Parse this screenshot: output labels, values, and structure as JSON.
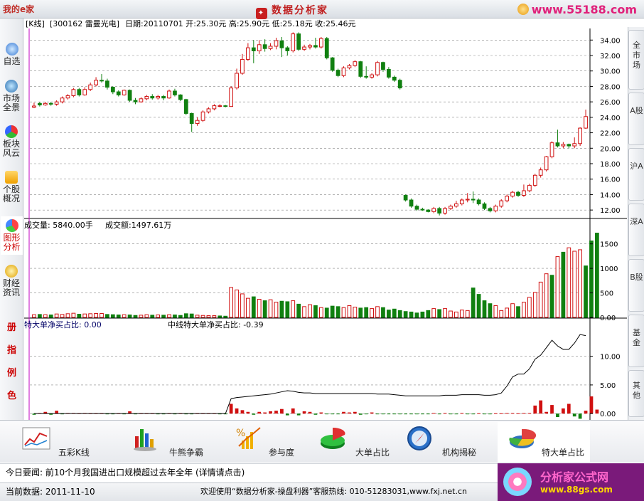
{
  "titlebar": {
    "left_logo": "我的e家",
    "app_title": "数据分析家",
    "site_link": "www.55188.com"
  },
  "left_nav": {
    "items": [
      {
        "label": "自选",
        "icon": "magnifier-icon"
      },
      {
        "label": "市场全景",
        "icon": "globe-icon"
      },
      {
        "label": "板块风云",
        "icon": "blocks-icon"
      },
      {
        "label": "个股概况",
        "icon": "stock-trend-icon"
      },
      {
        "label": "图形分析",
        "icon": "chart-graph-icon"
      },
      {
        "label": "财经资讯",
        "icon": "news-icon"
      },
      {
        "label": "册",
        "icon": ""
      },
      {
        "label": "指",
        "icon": ""
      },
      {
        "label": "例",
        "icon": ""
      },
      {
        "label": "色",
        "icon": ""
      }
    ]
  },
  "right_nav": {
    "items": [
      "全市场",
      "A股",
      "沪A",
      "深A",
      "B股",
      "基金",
      "其他"
    ]
  },
  "kline_header": {
    "chart_type": "[K线]",
    "stock": "[300162 雷曼光电]",
    "info": "日期:20110701 开:25.30元 高:25.90元 低:25.18元 收:25.46元"
  },
  "volume_header": {
    "volume": "成交量: 5840.00手",
    "amount": "成交额:1497.61万"
  },
  "indicator_header": {
    "left": "特大单净买占比: 0.00",
    "right": "中线特大单净买占比: -0.39"
  },
  "colors": {
    "up": "#d01010",
    "down": "#108010",
    "grid": "#888888",
    "cursor": "#c000c0",
    "line": "#000000"
  },
  "toolbar": {
    "items": [
      {
        "label": "五彩K线",
        "icon": "colorful-kline-icon"
      },
      {
        "label": "牛熊争霸",
        "icon": "bull-bear-icon"
      },
      {
        "label": "参与度",
        "icon": "percent-chart-icon"
      },
      {
        "label": "大单占比",
        "icon": "big-order-icon"
      },
      {
        "label": "机构揭秘",
        "icon": "compass-icon"
      },
      {
        "label": "特大单占比",
        "icon": "pie-chart-icon"
      }
    ]
  },
  "news": {
    "text": "今日要闻:  前10个月我国进出口规模超过去年全年 (详情请点击)"
  },
  "status": {
    "left": "当前数据: 2011-11-10",
    "right": "欢迎使用“数据分析家-操盘利器”客服热线: 010-51283031,www.fxj.net.cn"
  },
  "ad": {
    "title": "分析家公式网",
    "url": "www.88gs.com"
  },
  "chart_data": [
    {
      "type": "candlestick",
      "title": "",
      "ylim": [
        11,
        35.5
      ],
      "yticks": [
        "12.00",
        "14.00",
        "16.00",
        "18.00",
        "20.00",
        "22.00",
        "24.00",
        "26.00",
        "28.00",
        "30.00",
        "32.00",
        "34.00"
      ],
      "candles": [
        [
          25.3,
          25.46,
          25.9,
          25.18
        ],
        [
          25.8,
          25.6,
          26.0,
          25.4
        ],
        [
          25.6,
          25.8,
          26.0,
          25.5
        ],
        [
          25.8,
          25.7,
          26.0,
          25.5
        ],
        [
          25.7,
          26.0,
          26.2,
          25.5
        ],
        [
          26.0,
          26.5,
          26.7,
          25.8
        ],
        [
          26.5,
          26.8,
          27.0,
          26.3
        ],
        [
          26.8,
          27.6,
          27.8,
          26.6
        ],
        [
          27.6,
          26.9,
          27.8,
          26.7
        ],
        [
          26.9,
          27.6,
          27.9,
          26.8
        ],
        [
          27.6,
          28.2,
          28.5,
          27.4
        ],
        [
          28.2,
          28.8,
          29.2,
          28.0
        ],
        [
          28.8,
          28.7,
          29.6,
          28.5
        ],
        [
          28.7,
          27.9,
          29.0,
          27.6
        ],
        [
          27.9,
          27.3,
          28.0,
          27.0
        ],
        [
          27.3,
          26.9,
          27.5,
          26.7
        ],
        [
          26.9,
          27.5,
          27.6,
          26.8
        ],
        [
          27.5,
          26.2,
          27.6,
          26.0
        ],
        [
          26.2,
          26.0,
          26.5,
          25.7
        ],
        [
          26.0,
          26.4,
          26.6,
          25.9
        ],
        [
          26.4,
          26.7,
          26.9,
          26.2
        ],
        [
          26.7,
          26.5,
          27.0,
          26.3
        ],
        [
          26.5,
          26.7,
          26.9,
          26.3
        ],
        [
          26.7,
          26.5,
          26.9,
          26.2
        ],
        [
          26.5,
          27.4,
          27.6,
          26.4
        ],
        [
          27.4,
          26.9,
          27.7,
          26.7
        ],
        [
          26.9,
          26.3,
          27.0,
          26.1
        ],
        [
          26.3,
          24.5,
          26.4,
          24.3
        ],
        [
          24.5,
          23.2,
          24.6,
          22.1
        ],
        [
          23.2,
          23.6,
          24.0,
          22.9
        ],
        [
          23.6,
          24.7,
          24.9,
          23.4
        ],
        [
          24.7,
          25.1,
          25.3,
          24.5
        ],
        [
          25.1,
          25.5,
          25.7,
          24.9
        ],
        [
          25.5,
          25.5,
          25.7,
          25.3
        ],
        [
          25.5,
          25.4,
          25.6,
          25.3
        ],
        [
          25.4,
          27.8,
          28.0,
          27.6
        ],
        [
          27.8,
          29.7,
          30.3,
          27.6
        ],
        [
          29.7,
          31.5,
          32.2,
          29.5
        ],
        [
          31.5,
          33.0,
          33.6,
          31.3
        ],
        [
          33.0,
          32.6,
          34.0,
          31.0
        ],
        [
          32.6,
          33.4,
          34.0,
          32.2
        ],
        [
          33.4,
          32.9,
          34.1,
          32.5
        ],
        [
          32.9,
          33.2,
          33.6,
          32.7
        ],
        [
          33.2,
          33.9,
          34.3,
          32.8
        ],
        [
          33.9,
          33.0,
          34.4,
          31.8
        ],
        [
          33.0,
          32.6,
          33.2,
          32.0
        ],
        [
          32.6,
          34.8,
          35.0,
          32.4
        ],
        [
          34.8,
          32.8,
          35.0,
          32.6
        ],
        [
          32.8,
          33.1,
          33.4,
          32.6
        ],
        [
          33.1,
          33.3,
          33.5,
          32.8
        ],
        [
          33.3,
          33.1,
          34.3,
          32.9
        ],
        [
          33.1,
          34.2,
          34.4,
          32.9
        ],
        [
          34.2,
          31.7,
          34.4,
          31.5
        ],
        [
          31.7,
          30.1,
          31.8,
          29.9
        ],
        [
          30.1,
          29.4,
          30.3,
          29.2
        ],
        [
          29.4,
          30.4,
          30.6,
          29.2
        ],
        [
          30.4,
          30.7,
          30.9,
          30.2
        ],
        [
          30.7,
          31.2,
          31.4,
          30.5
        ],
        [
          31.2,
          29.3,
          31.3,
          29.1
        ],
        [
          29.3,
          29.2,
          30.6,
          29.0
        ],
        [
          29.2,
          29.5,
          29.7,
          29.0
        ],
        [
          29.5,
          31.1,
          31.3,
          29.3
        ],
        [
          31.1,
          30.2,
          31.2,
          29.9
        ],
        [
          30.2,
          29.2,
          30.5,
          29.0
        ],
        [
          29.2,
          28.8,
          29.4,
          28.6
        ],
        [
          28.8,
          27.8,
          29.0,
          27.6
        ],
        [
          13.9,
          13.3,
          14.0,
          13.1
        ],
        [
          13.3,
          12.5,
          13.5,
          12.3
        ],
        [
          12.5,
          12.1,
          12.7,
          11.9
        ],
        [
          12.1,
          12.0,
          12.3,
          11.9
        ],
        [
          12.0,
          11.8,
          12.1,
          11.7
        ],
        [
          11.8,
          12.2,
          12.4,
          11.6
        ],
        [
          12.2,
          11.6,
          12.4,
          11.3
        ],
        [
          11.6,
          12.2,
          12.4,
          11.4
        ],
        [
          12.2,
          12.5,
          12.7,
          12.0
        ],
        [
          12.5,
          12.8,
          13.2,
          12.3
        ],
        [
          12.8,
          13.3,
          13.5,
          12.6
        ],
        [
          13.3,
          13.4,
          14.2,
          13.0
        ],
        [
          13.4,
          13.3,
          14.4,
          12.9
        ],
        [
          13.3,
          12.8,
          13.5,
          12.6
        ],
        [
          12.8,
          12.2,
          13.0,
          12.0
        ],
        [
          12.2,
          11.9,
          12.4,
          11.7
        ],
        [
          11.9,
          12.5,
          12.7,
          11.7
        ],
        [
          12.5,
          13.2,
          13.4,
          12.3
        ],
        [
          13.2,
          13.8,
          14.0,
          13.0
        ],
        [
          13.8,
          14.3,
          14.5,
          13.6
        ],
        [
          14.3,
          13.9,
          14.5,
          13.7
        ],
        [
          13.9,
          14.5,
          15.3,
          13.7
        ],
        [
          14.5,
          15.2,
          15.4,
          14.3
        ],
        [
          15.2,
          16.5,
          16.7,
          15.0
        ],
        [
          16.5,
          17.2,
          17.5,
          16.2
        ],
        [
          17.2,
          18.9,
          19.0,
          17.0
        ],
        [
          18.9,
          20.7,
          20.9,
          18.7
        ],
        [
          20.7,
          20.3,
          22.4,
          20.1
        ],
        [
          20.3,
          20.5,
          20.8,
          20.0
        ],
        [
          20.5,
          20.3,
          20.6,
          20.0
        ],
        [
          20.3,
          20.6,
          21.4,
          20.0
        ],
        [
          20.6,
          22.6,
          22.7,
          20.3
        ],
        [
          22.6,
          24.1,
          25.0,
          22.5
        ]
      ]
    },
    {
      "type": "bar",
      "title": "",
      "ylim": [
        0,
        1800
      ],
      "yticks": [
        "0.00",
        "500",
        "1000",
        "1500"
      ],
      "values": [
        55,
        60,
        55,
        50,
        70,
        60,
        75,
        85,
        65,
        70,
        75,
        80,
        80,
        60,
        55,
        50,
        55,
        50,
        40,
        45,
        55,
        45,
        50,
        45,
        55,
        50,
        40,
        75,
        70,
        45,
        40,
        35,
        35,
        30,
        25,
        610,
        560,
        480,
        390,
        420,
        370,
        340,
        360,
        310,
        330,
        320,
        340,
        270,
        220,
        260,
        240,
        200,
        190,
        230,
        220,
        200,
        240,
        210,
        190,
        200,
        180,
        220,
        200,
        150,
        170,
        140,
        120,
        110,
        90,
        110,
        140,
        180,
        160,
        180,
        130,
        110,
        150,
        140,
        600,
        470,
        340,
        280,
        240,
        140,
        190,
        280,
        220,
        310,
        410,
        510,
        720,
        890,
        860,
        1240,
        1330,
        1420,
        1350,
        1380,
        1050,
        1560,
        1720
      ],
      "up": [
        1,
        0,
        1,
        0,
        1,
        1,
        1,
        1,
        0,
        1,
        1,
        1,
        1,
        0,
        0,
        0,
        1,
        0,
        0,
        1,
        1,
        0,
        1,
        0,
        1,
        0,
        0,
        0,
        0,
        1,
        1,
        1,
        1,
        0,
        0,
        1,
        1,
        1,
        1,
        0,
        1,
        0,
        1,
        1,
        0,
        0,
        1,
        0,
        1,
        1,
        0,
        1,
        0,
        0,
        0,
        1,
        1,
        1,
        0,
        0,
        1,
        1,
        0,
        0,
        0,
        0,
        0,
        0,
        0,
        0,
        0,
        1,
        0,
        1,
        1,
        1,
        1,
        1,
        0,
        0,
        0,
        0,
        1,
        1,
        1,
        1,
        0,
        1,
        1,
        1,
        1,
        1,
        0,
        1,
        0,
        1,
        1,
        1
      ]
    },
    {
      "type": "line",
      "title": "",
      "ylim": [
        -0.6,
        14.8
      ],
      "yticks": [
        "0.00",
        "5.00",
        "10.00"
      ],
      "line": [
        0,
        0,
        0,
        0,
        0,
        0,
        0,
        0,
        0,
        0,
        0,
        0,
        0,
        0,
        0,
        0,
        0,
        0,
        0,
        0,
        0,
        0,
        0,
        0,
        0,
        0,
        0,
        0,
        0,
        0,
        0,
        0,
        0,
        0,
        0,
        2.6,
        2.8,
        2.9,
        3.0,
        3.1,
        3.2,
        3.3,
        3.4,
        3.6,
        3.8,
        4.0,
        3.9,
        3.7,
        3.6,
        3.6,
        3.5,
        3.5,
        3.5,
        3.5,
        3.5,
        3.5,
        3.5,
        3.5,
        3.5,
        3.5,
        3.5,
        3.4,
        3.4,
        3.4,
        3.3,
        3.2,
        3.1,
        3.1,
        3.1,
        3.1,
        3.1,
        3.1,
        3.1,
        3.2,
        3.2,
        3.2,
        3.3,
        3.3,
        3.3,
        3.3,
        3.2,
        3.2,
        3.3,
        3.6,
        4.8,
        6.4,
        6.9,
        6.9,
        7.8,
        9.5,
        10.2,
        11.5,
        12.8,
        11.8,
        11.2,
        11.2,
        12.3,
        13.8,
        13.6
      ],
      "bars": [
        -0.2,
        0.1,
        0.3,
        -0.2,
        0.5,
        -0.1,
        0.1,
        0.1,
        0.05,
        0.1,
        0.05,
        0.05,
        0.05,
        -0.05,
        -0.05,
        0.05,
        -0.05,
        0.4,
        -0.05,
        0.05,
        0.05,
        0.05,
        -0.05,
        -0.05,
        0.05,
        -0.05,
        0.05,
        -0.05,
        -0.05,
        0.05,
        0.05,
        0.05,
        0.05,
        -0.05,
        -0.05,
        1.7,
        0.9,
        0.6,
        0.3,
        -0.2,
        0.3,
        0.2,
        0.4,
        0.5,
        0.8,
        -0.3,
        0.9,
        -0.3,
        0.4,
        0.3,
        -0.2,
        0.2,
        -0.1,
        -0.1,
        -0.1,
        0.3,
        0.2,
        0.3,
        -0.2,
        -0.1,
        0.2,
        -0.1,
        -0.1,
        -0.1,
        -0.1,
        -0.05,
        -0.05,
        -0.05,
        -0.05,
        -0.05,
        -0.05,
        0.1,
        -0.05,
        0.1,
        -0.05,
        -0.05,
        0.1,
        -0.05,
        -0.05,
        0.05,
        -0.05,
        -0.05,
        0.05,
        0.05,
        0.1,
        0.1,
        0.05,
        0.1,
        0.1,
        1.4,
        2.3,
        0.3,
        1.5,
        -0.6,
        0.9,
        1.7,
        -0.5,
        -0.9,
        0.5,
        3.0,
        0.7
      ]
    }
  ]
}
